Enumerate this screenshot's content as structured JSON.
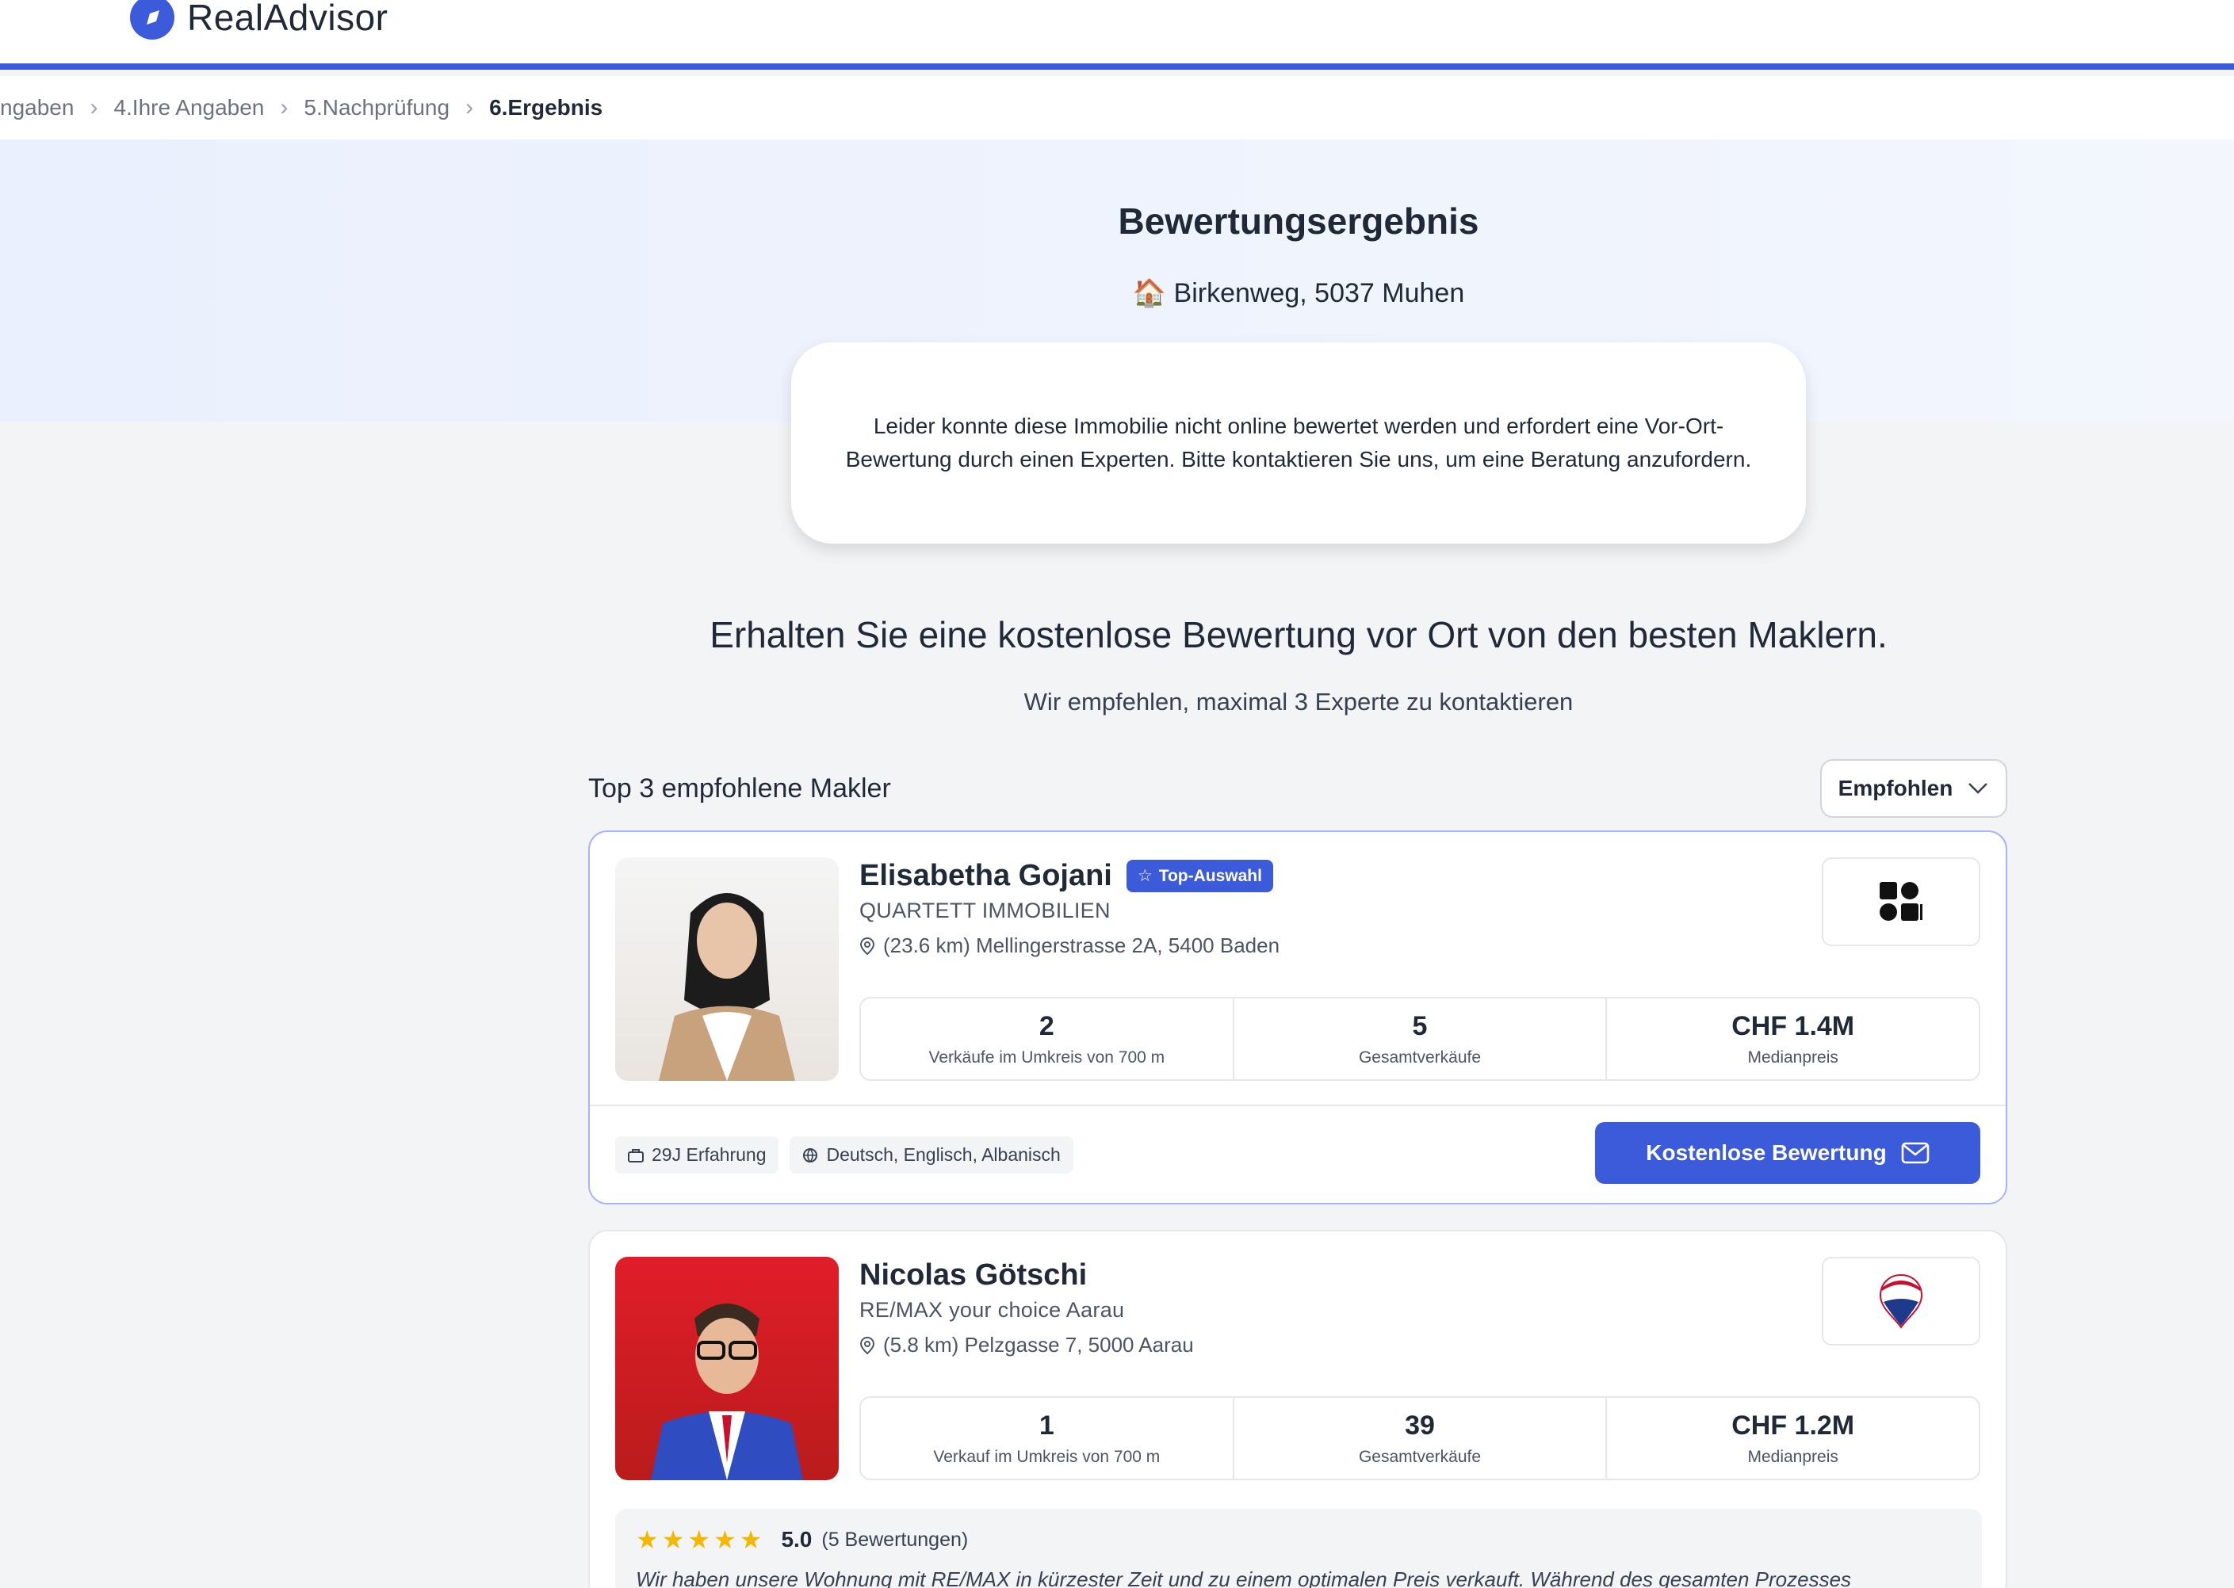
{
  "brand": {
    "name": "RealAdvisor",
    "color": "#3b5bdb"
  },
  "breadcrumb": [
    {
      "label": "ngaben",
      "active": false
    },
    {
      "label": "4.Ihre Angaben",
      "active": false
    },
    {
      "label": "5.Nachprüfung",
      "active": false
    },
    {
      "label": "6.Ergebnis",
      "active": true
    }
  ],
  "hero": {
    "title": "Bewertungsergebnis",
    "address_icon": "🏠",
    "address": "Birkenweg, 5037 Muhen",
    "notice": "Leider konnte diese Immobilie nicht online bewertet werden und erfordert eine Vor-Ort-Bewertung durch einen Experten. Bitte kontaktieren Sie uns, um eine Beratung anzufordern."
  },
  "section": {
    "title": "Erhalten Sie eine kostenlose Bewertung vor Ort von den besten Maklern.",
    "subtitle": "Wir empfehlen, maximal 3 Experte zu kontaktieren"
  },
  "list": {
    "title": "Top 3 empfohlene Makler",
    "sort_label": "Empfohlen"
  },
  "agents": [
    {
      "name": "Elisabetha Gojani",
      "badge": "Top-Auswahl",
      "agency": "QUARTETT IMMOBILIEN",
      "location": "(23.6 km) Mellingerstrasse 2A, 5400 Baden",
      "stats": [
        {
          "value": "2",
          "label": "Verkäufe im Umkreis von 700 m"
        },
        {
          "value": "5",
          "label": "Gesamtverkäufe"
        },
        {
          "value": "CHF 1.4M",
          "label": "Medianpreis"
        }
      ],
      "chips": [
        "29J Erfahrung",
        "Deutsch, Englisch, Albanisch"
      ],
      "cta": "Kostenlose Bewertung"
    },
    {
      "name": "Nicolas Götschi",
      "agency": "RE/MAX your choice Aarau",
      "location": "(5.8 km) Pelzgasse 7, 5000 Aarau",
      "stats": [
        {
          "value": "1",
          "label": "Verkauf im Umkreis von 700 m"
        },
        {
          "value": "39",
          "label": "Gesamtverkäufe"
        },
        {
          "value": "CHF 1.2M",
          "label": "Medianpreis"
        }
      ],
      "rating": {
        "stars": "★★★★★",
        "score": "5.0",
        "count": "(5 Bewertungen)"
      },
      "review": "Wir haben unsere Wohnung mit RE/MAX in kürzester Zeit und zu einem optimalen Preis verkauft. Während des gesamten Prozesses"
    }
  ]
}
